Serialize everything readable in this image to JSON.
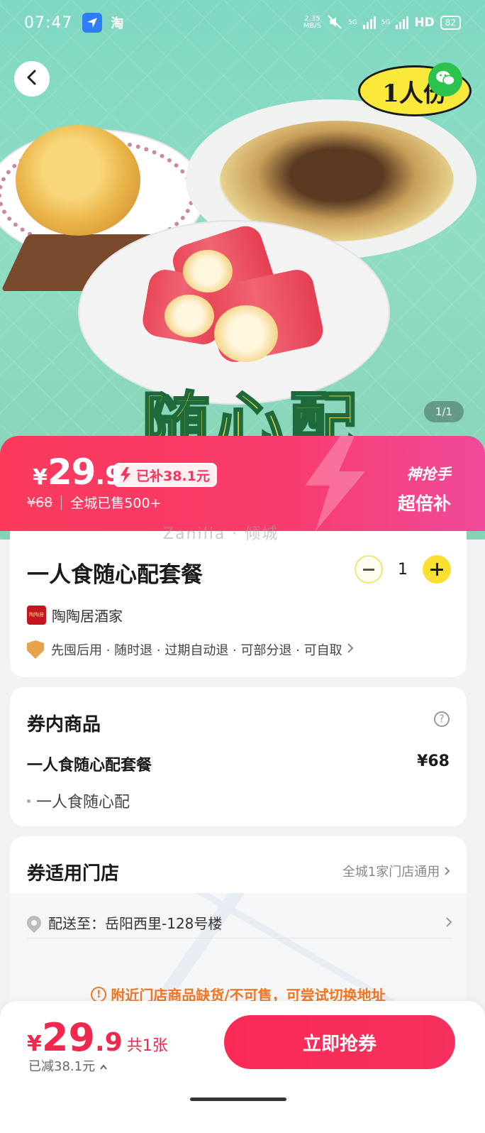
{
  "status_bar": {
    "time": "07:47",
    "app_icon_label": "淘",
    "speed_value": "2.35",
    "speed_unit": "MB/S",
    "network1": "5G",
    "network2": "5G",
    "hd": "HD",
    "battery": "82"
  },
  "hero": {
    "badge_text": "1人份",
    "overlay_text": "随心配",
    "pager": "1/1"
  },
  "price_banner": {
    "currency": "¥",
    "price_int": "29",
    "price_dec": ".9",
    "subsidy_tag": "已补38.1元",
    "original_price": "¥68",
    "sold": "全城已售500+",
    "promo_line1": "神抢手",
    "promo_line2": "超倍补"
  },
  "watermark": "Zanilia · 倾城",
  "product": {
    "title": "一人食随心配套餐",
    "quantity": "1",
    "shop_name": "陶陶居酒家",
    "shop_logo_text": "陶陶居酒家",
    "guarantees": "先囤后用 · 随时退 · 过期自动退 · 可部分退 · 可自取"
  },
  "contents": {
    "title": "券内商品",
    "item_name": "一人食随心配套餐",
    "item_price": "¥68",
    "item_sub": "一人食随心配"
  },
  "stores": {
    "title": "券适用门店",
    "link": "全城1家门店通用",
    "address": "配送至：岳阳西里-128号楼",
    "warning": "附近门店商品缺货/不可售，可尝试切换地址"
  },
  "bottom_bar": {
    "currency": "¥",
    "price_int": "29",
    "price_dec": ".9",
    "count": "共1张",
    "saved": "已减38.1元",
    "buy_button": "立即抢券"
  },
  "colors": {
    "accent": "#f2274c",
    "banner_start": "#fb3a5c",
    "banner_end": "#f14a9a",
    "stepper_yellow": "#fbe033",
    "warning": "#f37521"
  }
}
